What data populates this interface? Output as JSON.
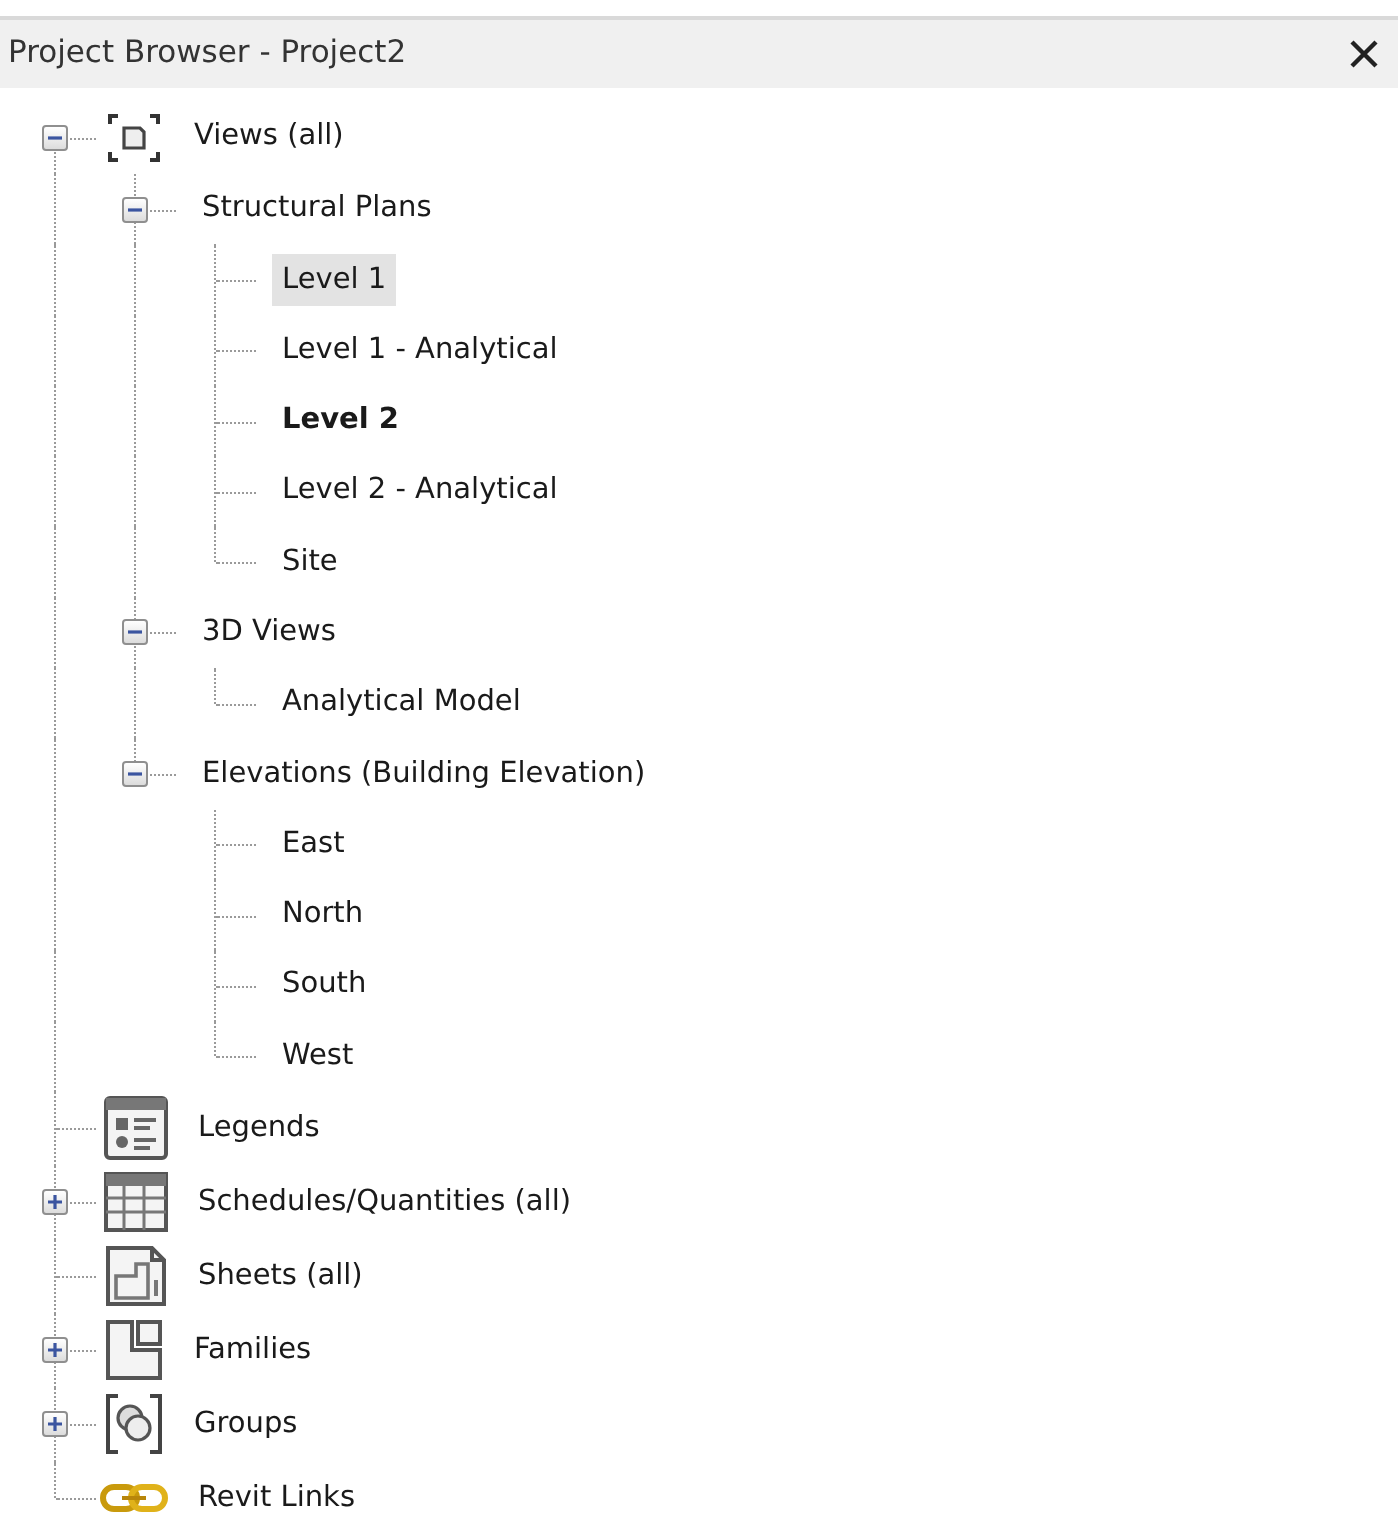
{
  "window": {
    "title": "Project Browser - Project2"
  },
  "tree": [
    {
      "label": "Views (all)",
      "kind": "views",
      "expanded": true,
      "selected": false,
      "current": false,
      "children": [
        {
          "label": "Structural Plans",
          "expanded": true,
          "selected": false,
          "current": false,
          "children": [
            {
              "label": "Level 1",
              "selected": true,
              "current": false
            },
            {
              "label": "Level 1 - Analytical",
              "selected": false,
              "current": false
            },
            {
              "label": "Level 2",
              "selected": false,
              "current": true
            },
            {
              "label": "Level 2 - Analytical",
              "selected": false,
              "current": false
            },
            {
              "label": "Site",
              "selected": false,
              "current": false
            }
          ]
        },
        {
          "label": "3D Views",
          "expanded": true,
          "selected": false,
          "current": false,
          "children": [
            {
              "label": "Analytical Model",
              "selected": false,
              "current": false
            }
          ]
        },
        {
          "label": "Elevations (Building Elevation)",
          "expanded": true,
          "selected": false,
          "current": false,
          "children": [
            {
              "label": "East",
              "selected": false,
              "current": false
            },
            {
              "label": "North",
              "selected": false,
              "current": false
            },
            {
              "label": "South",
              "selected": false,
              "current": false
            },
            {
              "label": "West",
              "selected": false,
              "current": false
            }
          ]
        }
      ]
    },
    {
      "label": "Legends",
      "kind": "legends",
      "selected": false,
      "current": false
    },
    {
      "label": "Schedules/Quantities (all)",
      "kind": "schedules",
      "expanded": false,
      "selected": false,
      "current": false
    },
    {
      "label": "Sheets (all)",
      "kind": "sheets",
      "selected": false,
      "current": false
    },
    {
      "label": "Families",
      "kind": "families",
      "expanded": false,
      "selected": false,
      "current": false
    },
    {
      "label": "Groups",
      "kind": "groups",
      "expanded": false,
      "selected": false,
      "current": false
    },
    {
      "label": "Revit Links",
      "kind": "links",
      "selected": false,
      "current": false
    }
  ]
}
